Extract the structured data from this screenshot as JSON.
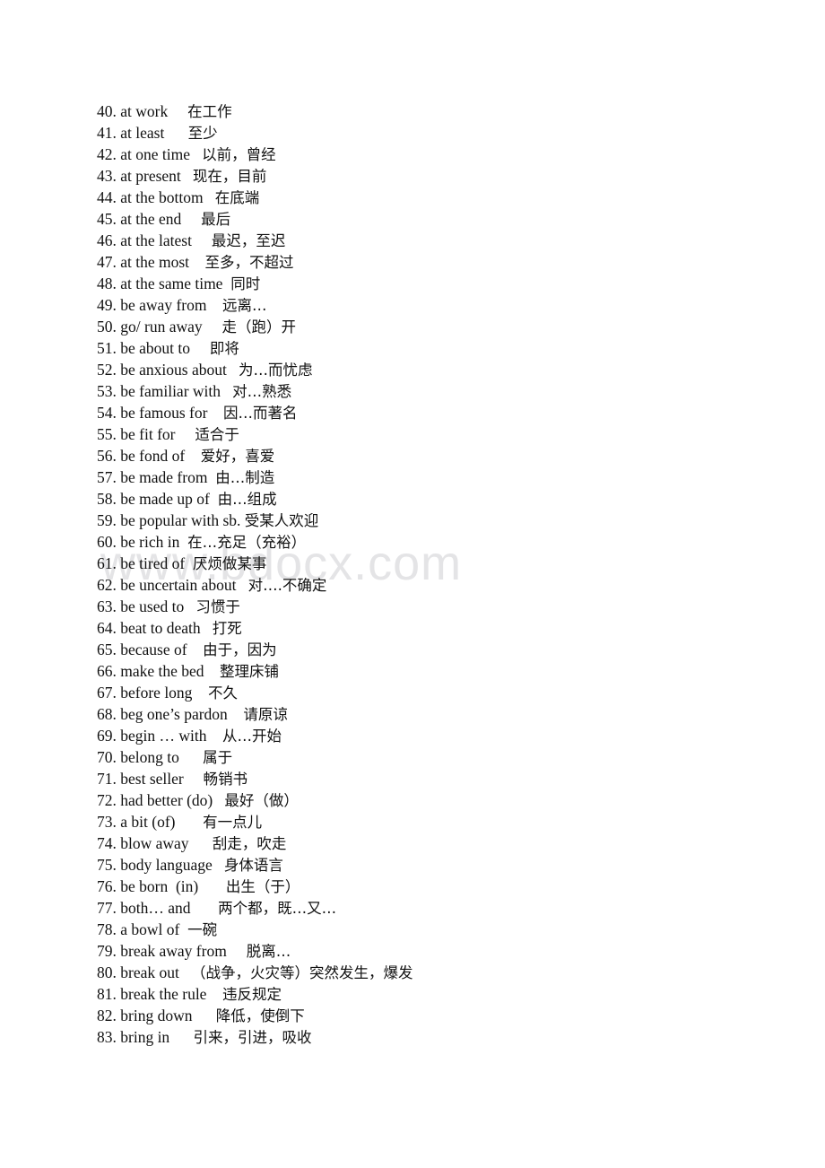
{
  "document": {
    "type": "vocabulary-phrase-list",
    "page_background": "#ffffff",
    "text_color": "#111111"
  },
  "watermark": {
    "text": "www.bdocx.com",
    "color": "#e4e4e6"
  },
  "entries": [
    {
      "num": "40.",
      "en": "at work",
      "gap": "     ",
      "zh": "在工作"
    },
    {
      "num": "41.",
      "en": "at least",
      "gap": "      ",
      "zh": "至少"
    },
    {
      "num": "42.",
      "en": "at one time",
      "gap": "   ",
      "zh": "以前，曾经"
    },
    {
      "num": "43.",
      "en": "at present",
      "gap": "   ",
      "zh": "现在，目前"
    },
    {
      "num": "44.",
      "en": "at the bottom",
      "gap": "   ",
      "zh": "在底端"
    },
    {
      "num": "45.",
      "en": "at the end",
      "gap": "     ",
      "zh": "最后"
    },
    {
      "num": "46.",
      "en": "at the latest",
      "gap": "     ",
      "zh": "最迟，至迟"
    },
    {
      "num": "47.",
      "en": "at the most",
      "gap": "    ",
      "zh": "至多，不超过"
    },
    {
      "num": "48.",
      "en": "at the same time",
      "gap": "  ",
      "zh": "同时"
    },
    {
      "num": "49.",
      "en": "be away from",
      "gap": "    ",
      "zh": "远离…"
    },
    {
      "num": "50.",
      "en": "go/ run away",
      "gap": "     ",
      "zh": "走（跑）开"
    },
    {
      "num": "51.",
      "en": "be about to",
      "gap": "     ",
      "zh": "即将"
    },
    {
      "num": "52.",
      "en": "be anxious about",
      "gap": "   ",
      "zh": "为…而忧虑"
    },
    {
      "num": "53.",
      "en": "be familiar with",
      "gap": "   ",
      "zh": "对…熟悉"
    },
    {
      "num": "54.",
      "en": "be famous for",
      "gap": "    ",
      "zh": "因…而著名"
    },
    {
      "num": "55.",
      "en": "be fit for",
      "gap": "     ",
      "zh": "适合于"
    },
    {
      "num": "56.",
      "en": "be fond of",
      "gap": "    ",
      "zh": "爱好，喜爱"
    },
    {
      "num": "57.",
      "en": "be made from",
      "gap": "  ",
      "zh": "由…制造"
    },
    {
      "num": "58.",
      "en": "be made up of",
      "gap": "  ",
      "zh": "由…组成"
    },
    {
      "num": "59.",
      "en": "be popular with sb.",
      "gap": " ",
      "zh": "受某人欢迎"
    },
    {
      "num": "60.",
      "en": "be rich in",
      "gap": "  ",
      "zh": "在…充足（充裕）"
    },
    {
      "num": "61.",
      "en": "be tired of",
      "gap": "  ",
      "zh": "厌烦做某事"
    },
    {
      "num": "62.",
      "en": "be uncertain about",
      "gap": "   ",
      "zh": "对….不确定"
    },
    {
      "num": "63.",
      "en": "be used to",
      "gap": "   ",
      "zh": "习惯于"
    },
    {
      "num": "64.",
      "en": "beat to death",
      "gap": "   ",
      "zh": "打死"
    },
    {
      "num": "65.",
      "en": "because of",
      "gap": "    ",
      "zh": "由于，因为"
    },
    {
      "num": "66.",
      "en": "make the bed",
      "gap": "    ",
      "zh": "整理床铺"
    },
    {
      "num": "67.",
      "en": "before long",
      "gap": "    ",
      "zh": "不久"
    },
    {
      "num": "68.",
      "en": "beg one’s pardon",
      "gap": "    ",
      "zh": "请原谅"
    },
    {
      "num": "69.",
      "en": "begin … with",
      "gap": "    ",
      "zh": "从…开始"
    },
    {
      "num": "70.",
      "en": "belong to",
      "gap": "      ",
      "zh": "属于"
    },
    {
      "num": "71.",
      "en": "best seller",
      "gap": "     ",
      "zh": "畅销书"
    },
    {
      "num": "72.",
      "en": "had better (do)",
      "gap": "   ",
      "zh": "最好（做）"
    },
    {
      "num": "73.",
      "en": "a bit (of)",
      "gap": "       ",
      "zh": "有一点儿"
    },
    {
      "num": "74.",
      "en": "blow away",
      "gap": "      ",
      "zh": "刮走，吹走"
    },
    {
      "num": "75.",
      "en": "body language",
      "gap": "   ",
      "zh": "身体语言"
    },
    {
      "num": "76.",
      "en": "be born  (in)",
      "gap": "       ",
      "zh": "出生（于）"
    },
    {
      "num": "77.",
      "en": "both… and",
      "gap": "       ",
      "zh": "两个都，既…又…"
    },
    {
      "num": "78.",
      "en": "a bowl of",
      "gap": "  ",
      "zh": "一碗"
    },
    {
      "num": "79.",
      "en": "break away from",
      "gap": "     ",
      "zh": "脱离…"
    },
    {
      "num": "80.",
      "en": "break out",
      "gap": "   ",
      "zh": "（战争，火灾等）突然发生，爆发"
    },
    {
      "num": "81.",
      "en": "break the rule",
      "gap": "    ",
      "zh": "违反规定"
    },
    {
      "num": "82.",
      "en": "bring down",
      "gap": "      ",
      "zh": "降低，使倒下"
    },
    {
      "num": "83.",
      "en": "bring in",
      "gap": "      ",
      "zh": "引来，引进，吸收"
    }
  ]
}
